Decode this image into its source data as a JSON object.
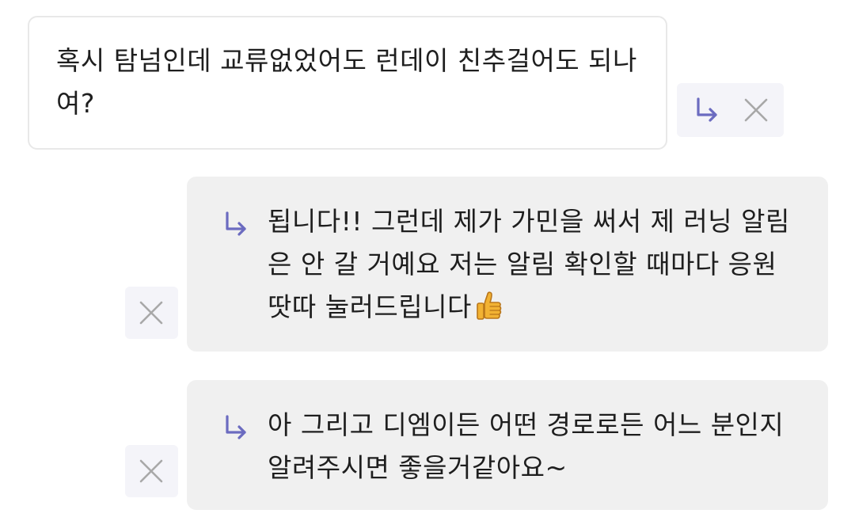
{
  "messages": [
    {
      "direction": "incoming",
      "text": "혹시 탐넘인데 교류없었어도 런데이 친추걸어도 되나여?",
      "actions": [
        "reply-arrow-icon",
        "close-icon"
      ]
    },
    {
      "direction": "outgoing",
      "reply_icon": "reply-arrow-icon",
      "text": "됩니다!! 그런데 제가 가민을 써서 제 러닝 알림은 안 갈 거예요 저는 알림 확인할 때마다 응원 땃따 눌러드립니다",
      "emoji": "thumbs-up-icon",
      "actions": [
        "close-icon"
      ]
    },
    {
      "direction": "outgoing",
      "reply_icon": "reply-arrow-icon",
      "text": "아 그리고 디엠이든 어떤 경로로든 어느 분인지 알려주시면 좋을거같아요~",
      "actions": [
        "close-icon"
      ]
    }
  ],
  "colors": {
    "accent_reply": "#6b6bc0",
    "close_icon": "#a8a8a8",
    "outgoing_bubble": "#f0f0f0",
    "incoming_border": "#e8e8e8",
    "action_bg": "#f4f4f9",
    "text": "#1e1e1e"
  }
}
